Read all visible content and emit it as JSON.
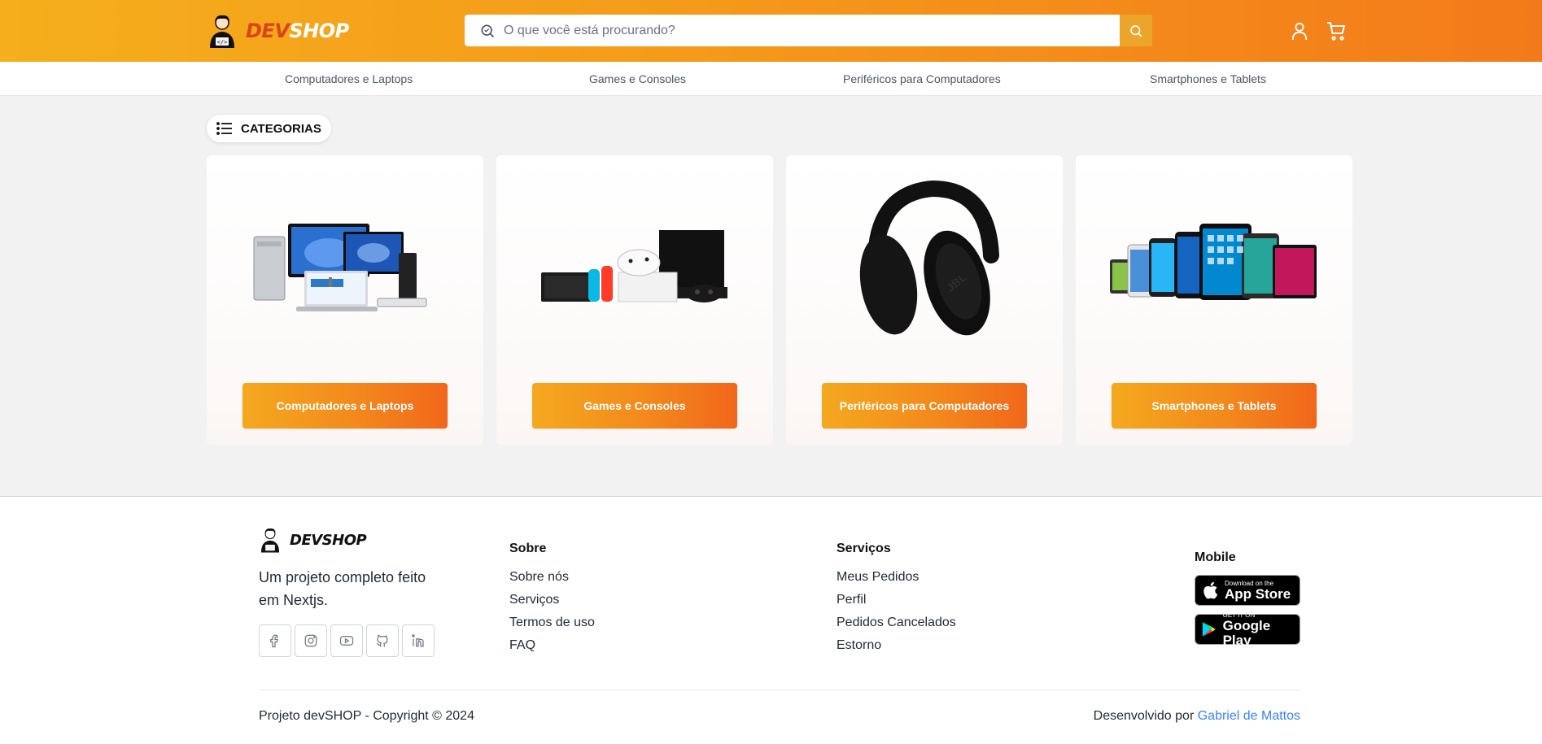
{
  "brand": {
    "logo_dev": "DEV",
    "logo_shop": "SHOP",
    "color_primary": "#f59a1a",
    "color_accent": "#d9461b"
  },
  "header": {
    "search_placeholder": "O que você está procurando?",
    "icons": [
      "search-icon",
      "user-icon",
      "cart-icon"
    ]
  },
  "nav": {
    "items": [
      {
        "label": "Computadores e Laptops"
      },
      {
        "label": "Games e Consoles"
      },
      {
        "label": "Periféricos para Computadores"
      },
      {
        "label": "Smartphones e Tablets"
      }
    ]
  },
  "main": {
    "categories_title": "CATEGORIAS",
    "cards": [
      {
        "button": "Computadores e Laptops",
        "image": "computers-image"
      },
      {
        "button": "Games e Consoles",
        "image": "consoles-image"
      },
      {
        "button": "Periféricos para Computadores",
        "image": "headphone-image"
      },
      {
        "button": "Smartphones e Tablets",
        "image": "phones-image"
      }
    ]
  },
  "footer": {
    "logo_dev": "DEV",
    "logo_shop": "SHOP",
    "description": "Um projeto completo feito em Nextjs.",
    "socials": [
      "facebook-icon",
      "instagram-icon",
      "youtube-icon",
      "github-icon",
      "linkedin-icon"
    ],
    "sobre": {
      "title": "Sobre",
      "links": [
        "Sobre nós",
        "Serviços",
        "Termos de uso",
        "FAQ"
      ]
    },
    "servicos": {
      "title": "Serviços",
      "links": [
        "Meus Pedidos",
        "Perfil",
        "Pedidos Cancelados",
        "Estorno"
      ]
    },
    "mobile": {
      "title": "Mobile",
      "appstore_small": "Download on the",
      "appstore_big": "App Store",
      "googleplay_small": "GET IT ON",
      "googleplay_big": "Google Play"
    },
    "copyright": "Projeto devSHOP - Copyright © 2024",
    "developed_by": "Desenvolvido por",
    "developer": "Gabriel de Mattos"
  }
}
